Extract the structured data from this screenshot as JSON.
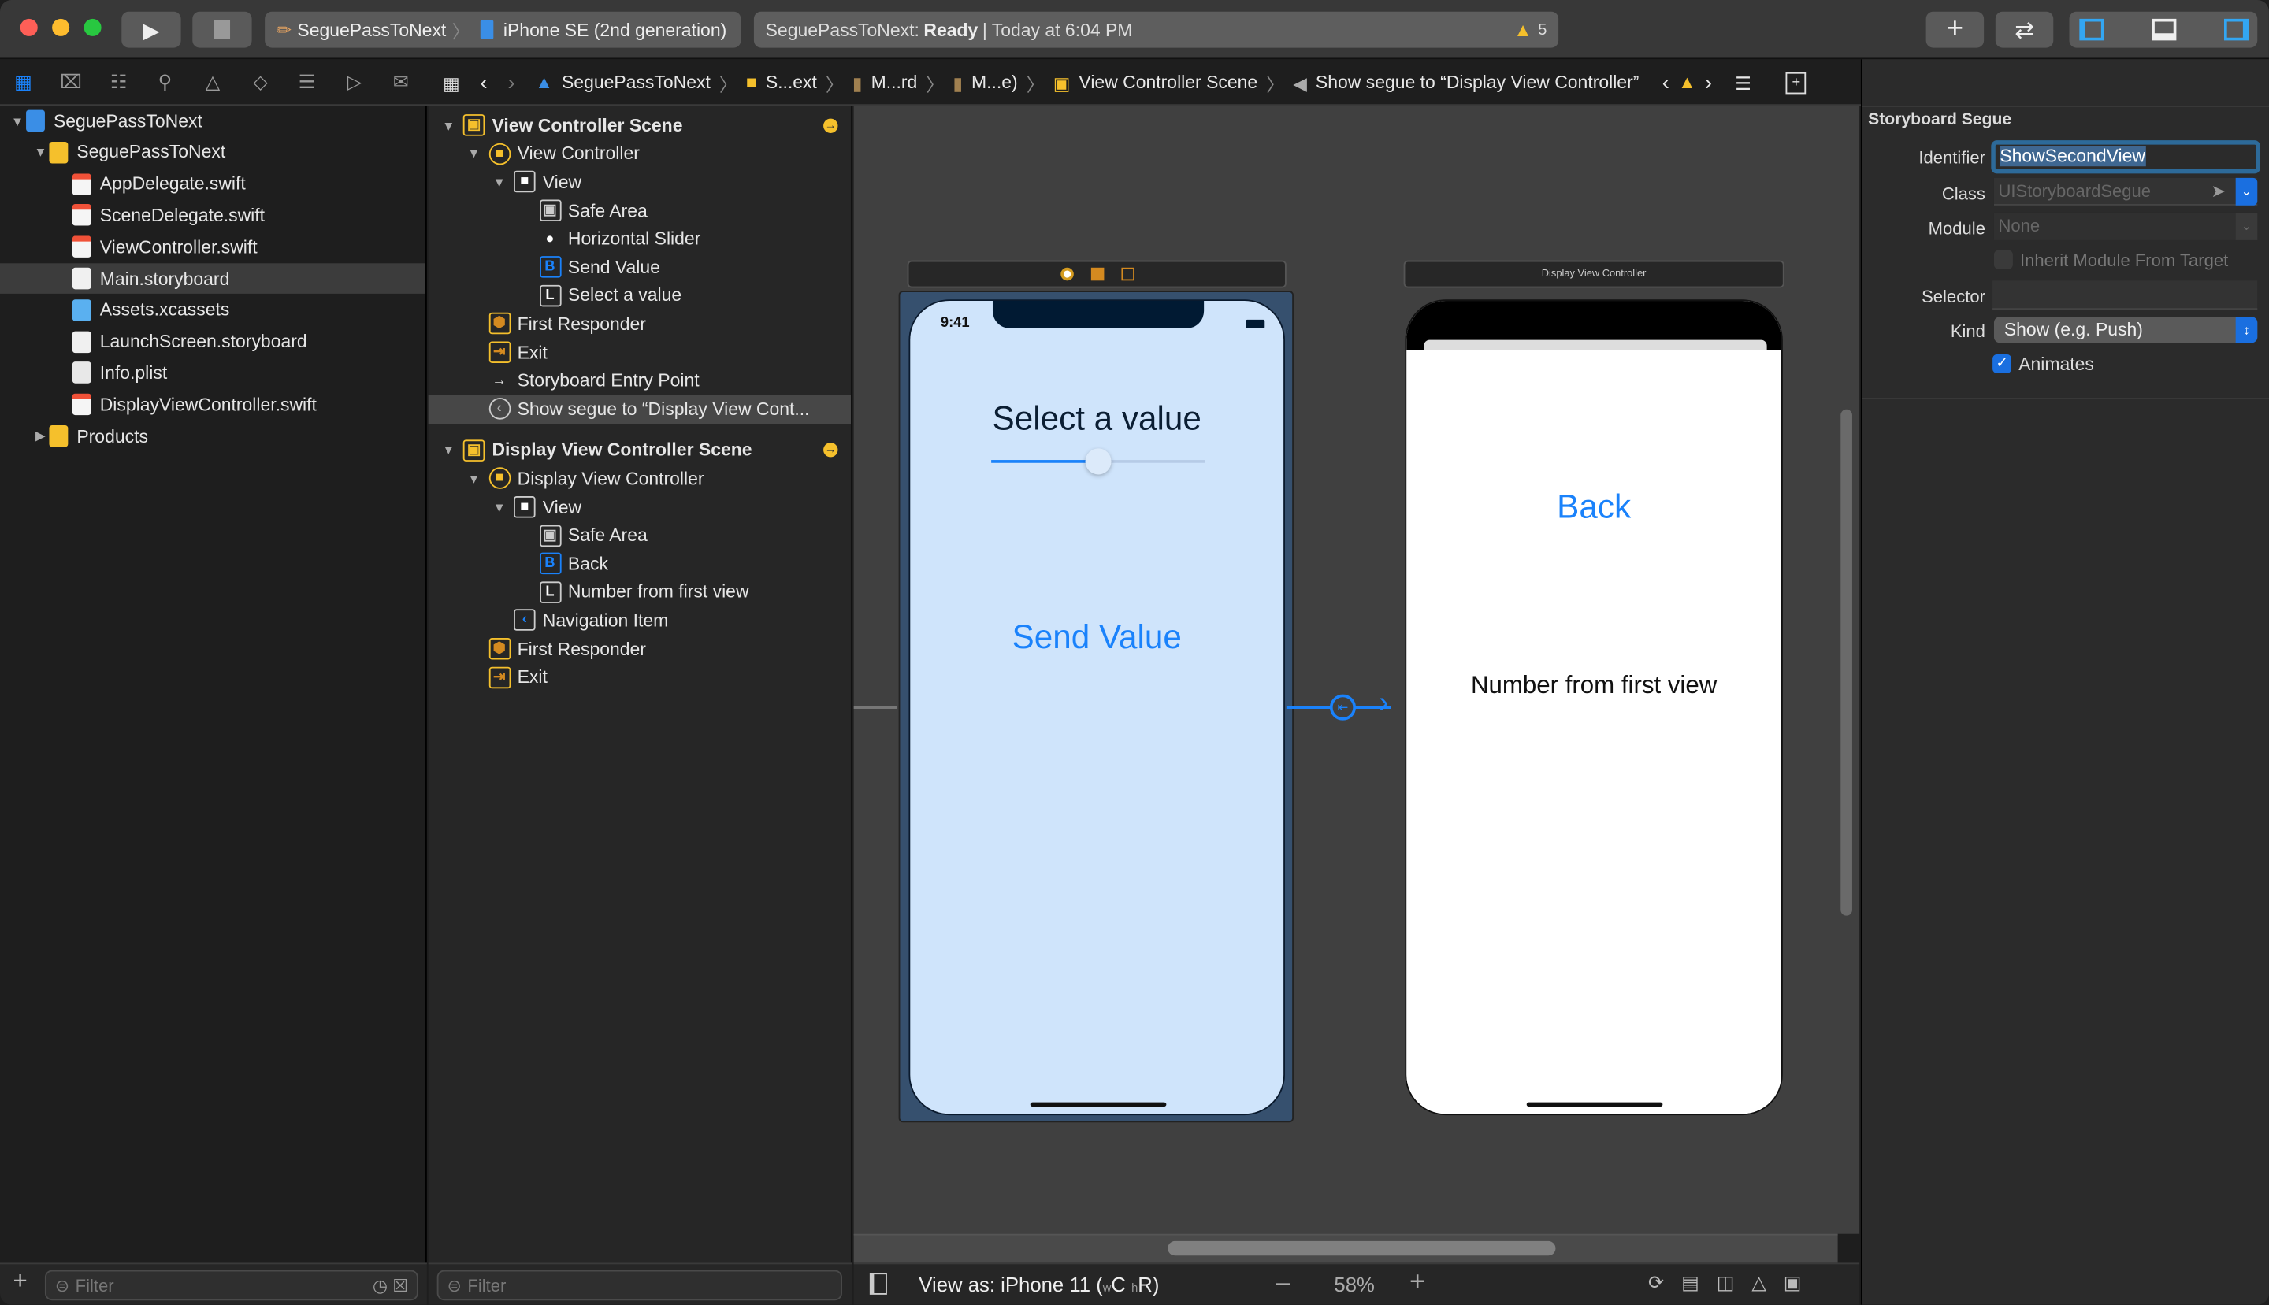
{
  "titlebar": {
    "scheme_project": "SeguePassToNext",
    "scheme_device": "iPhone SE (2nd generation)",
    "status_project": "SeguePassToNext: ",
    "status_state": "Ready",
    "status_time": " | Today at 6:04 PM",
    "warning_count": "5"
  },
  "jumpbar": {
    "items": [
      "SeguePassToNext",
      "S...ext",
      "M...rd",
      "M...e)",
      "View Controller Scene",
      "Show segue to “Display View Controller”"
    ]
  },
  "navigator": {
    "items": [
      {
        "label": "SeguePassToNext",
        "level": 0,
        "icon": "project",
        "open": true
      },
      {
        "label": "SeguePassToNext",
        "level": 1,
        "icon": "folder",
        "open": true
      },
      {
        "label": "AppDelegate.swift",
        "level": 2,
        "icon": "swift"
      },
      {
        "label": "SceneDelegate.swift",
        "level": 2,
        "icon": "swift"
      },
      {
        "label": "ViewController.swift",
        "level": 2,
        "icon": "swift"
      },
      {
        "label": "Main.storyboard",
        "level": 2,
        "icon": "storyboard",
        "selected": true
      },
      {
        "label": "Assets.xcassets",
        "level": 2,
        "icon": "assets"
      },
      {
        "label": "LaunchScreen.storyboard",
        "level": 2,
        "icon": "storyboard"
      },
      {
        "label": "Info.plist",
        "level": 2,
        "icon": "plist"
      },
      {
        "label": "DisplayViewController.swift",
        "level": 2,
        "icon": "swift"
      },
      {
        "label": "Products",
        "level": 1,
        "icon": "folder",
        "open": false
      }
    ],
    "filter_placeholder": "Filter"
  },
  "outline": {
    "items": [
      {
        "label": "View Controller Scene",
        "level": 0,
        "icon": "scene",
        "bold": true,
        "open": true,
        "badge": true
      },
      {
        "label": "View Controller",
        "level": 1,
        "icon": "vc",
        "open": true
      },
      {
        "label": "View",
        "level": 2,
        "icon": "view",
        "open": true
      },
      {
        "label": "Safe Area",
        "level": 3,
        "icon": "safe"
      },
      {
        "label": "Horizontal Slider",
        "level": 3,
        "icon": "slider"
      },
      {
        "label": "Send Value",
        "level": 3,
        "icon": "B"
      },
      {
        "label": "Select a value",
        "level": 3,
        "icon": "L"
      },
      {
        "label": "First Responder",
        "level": 1,
        "icon": "responder"
      },
      {
        "label": "Exit",
        "level": 1,
        "icon": "exit"
      },
      {
        "label": "Storyboard Entry Point",
        "level": 1,
        "icon": "arrow"
      },
      {
        "label": "Show segue to “Display View Cont...",
        "level": 1,
        "icon": "segue",
        "selected": true
      },
      {
        "label": "Display View Controller Scene",
        "level": 0,
        "icon": "scene",
        "bold": true,
        "open": true,
        "badge": true,
        "gap": true
      },
      {
        "label": "Display View Controller",
        "level": 1,
        "icon": "vc",
        "open": true
      },
      {
        "label": "View",
        "level": 2,
        "icon": "view",
        "open": true
      },
      {
        "label": "Safe Area",
        "level": 3,
        "icon": "safe"
      },
      {
        "label": "Back",
        "level": 3,
        "icon": "B"
      },
      {
        "label": "Number from first view",
        "level": 3,
        "icon": "L"
      },
      {
        "label": "Navigation Item",
        "level": 2,
        "icon": "navitem"
      },
      {
        "label": "First Responder",
        "level": 1,
        "icon": "responder"
      },
      {
        "label": "Exit",
        "level": 1,
        "icon": "exit"
      }
    ],
    "filter_placeholder": "Filter"
  },
  "canvas": {
    "first": {
      "time": "9:41",
      "title": "Select a value",
      "slider_value": 0.5,
      "button": "Send Value"
    },
    "second": {
      "scene_title": "Display View Controller",
      "button": "Back",
      "label": "Number from first view"
    },
    "view_as": "View as: iPhone 11 (",
    "view_as_w": "w",
    "view_as_c": "C ",
    "view_as_h": "h",
    "view_as_r": "R)",
    "zoom": "58%"
  },
  "inspector": {
    "section": "Storyboard Segue",
    "identifier_label": "Identifier",
    "identifier": "ShowSecondView",
    "class_label": "Class",
    "class_value": "UIStoryboardSegue",
    "module_label": "Module",
    "module_value": "None",
    "inherit_label": "Inherit Module From Target",
    "inherit_checked": false,
    "selector_label": "Selector",
    "selector_value": "",
    "kind_label": "Kind",
    "kind_value": "Show (e.g. Push)",
    "animates_label": "Animates",
    "animates_checked": true
  },
  "colors": {
    "accent": "#1a82fb",
    "warning": "#f5c02c",
    "phone_bg": "#cfe4fb"
  }
}
